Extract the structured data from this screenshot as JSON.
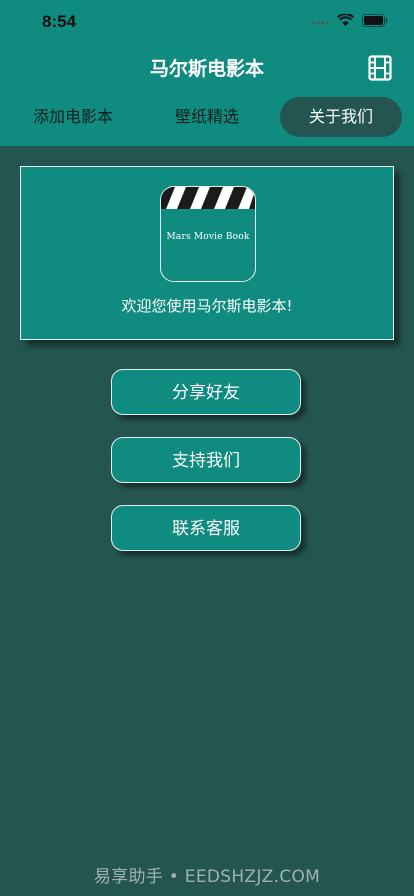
{
  "status": {
    "time": "8:54"
  },
  "nav": {
    "title": "马尔斯电影本"
  },
  "tabs": [
    {
      "label": "添加电影本",
      "active": false
    },
    {
      "label": "壁纸精选",
      "active": false
    },
    {
      "label": "关于我们",
      "active": true
    }
  ],
  "card": {
    "logo_text": "Mars Movie Book",
    "welcome": "欢迎您使用马尔斯电影本!"
  },
  "buttons": {
    "share": "分享好友",
    "support": "支持我们",
    "contact": "联系客服"
  },
  "watermark": "易享助手 • EEDSHZJZ.COM",
  "colors": {
    "primary": "#0f8b80",
    "background": "#255550",
    "text": "#ffffff"
  }
}
